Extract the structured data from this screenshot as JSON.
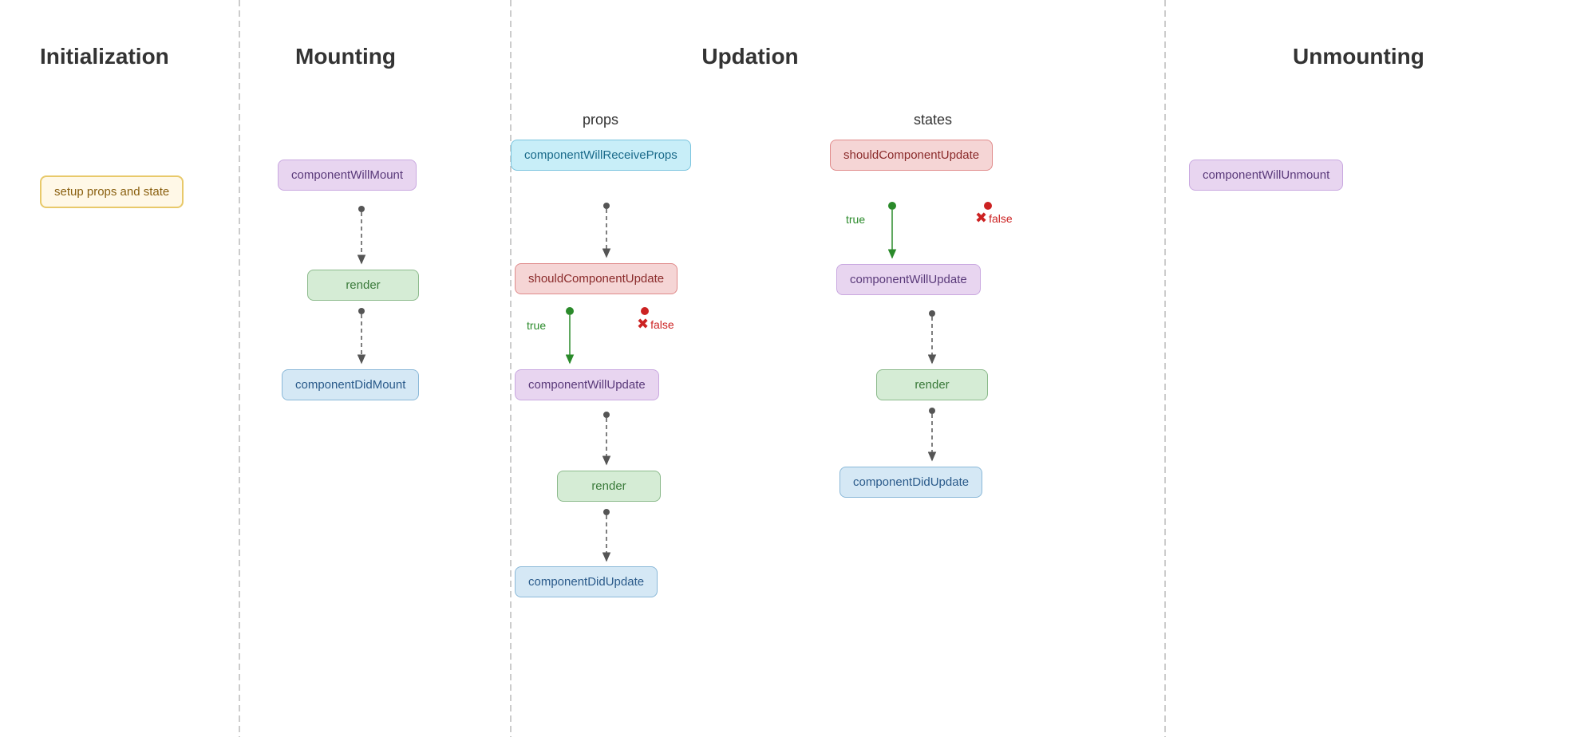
{
  "sections": {
    "initialization": {
      "title": "Initialization",
      "node": "setup props and state"
    },
    "mounting": {
      "title": "Mounting",
      "nodes": {
        "willMount": "componentWillMount",
        "render": "render",
        "didMount": "componentDidMount"
      }
    },
    "updation": {
      "title": "Updation",
      "props_label": "props",
      "states_label": "states",
      "nodes": {
        "willReceiveProps": "componentWillReceiveProps",
        "shouldUpdate_props": "shouldComponentUpdate",
        "willUpdate_props": "componentWillUpdate",
        "render_props": "render",
        "didUpdate_props": "componentDidUpdate",
        "shouldUpdate_states": "shouldComponentUpdate",
        "willUpdate_states": "componentWillUpdate",
        "render_states": "render",
        "didUpdate_states": "componentDidUpdate"
      },
      "true_label": "true",
      "false_label": "false"
    },
    "unmounting": {
      "title": "Unmounting",
      "node": "componentWillUnmount"
    }
  }
}
